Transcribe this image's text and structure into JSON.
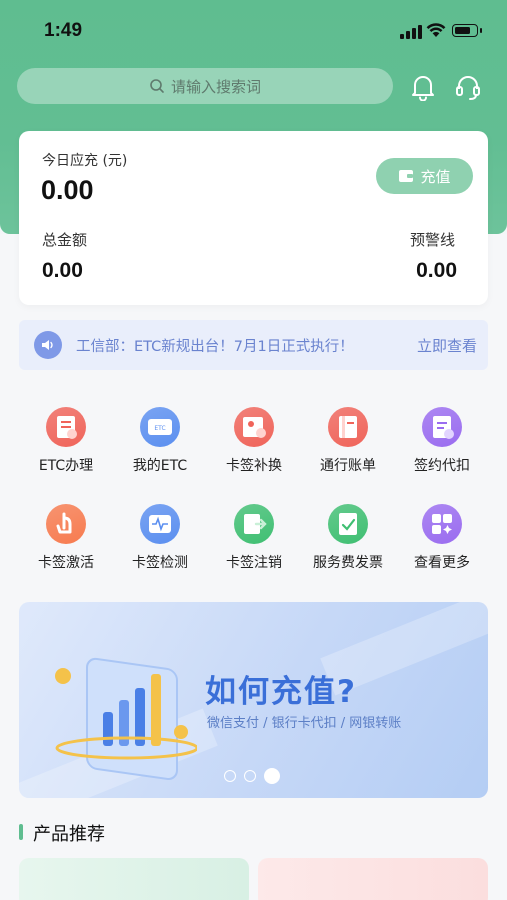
{
  "status_bar": {
    "time": "1:49",
    "battery_level": 0.75
  },
  "search": {
    "placeholder": "请输入搜索词"
  },
  "header_icons": [
    "bell-icon",
    "headset-icon"
  ],
  "balance": {
    "today_label": "今日应充 (元)",
    "today_value": "0.00",
    "recharge_label": "充值",
    "total_label": "总金额",
    "total_value": "0.00",
    "warning_label": "预警线",
    "warning_value": "0.00"
  },
  "notice": {
    "text": "工信部：ETC新规出台！7月1日正式执行！",
    "link": "立即查看"
  },
  "services": [
    {
      "label": "ETC办理",
      "icon": "etc-apply-icon",
      "color": "#f0645a"
    },
    {
      "label": "我的ETC",
      "icon": "my-etc-card-icon",
      "color": "#5b8ff0"
    },
    {
      "label": "卡签补换",
      "icon": "card-replace-icon",
      "color": "#f0645a"
    },
    {
      "label": "通行账单",
      "icon": "toll-bill-icon",
      "color": "#f0645a"
    },
    {
      "label": "签约代扣",
      "icon": "auto-debit-icon",
      "color": "#9a6cf0"
    },
    {
      "label": "卡签激活",
      "icon": "card-activate-icon",
      "color": "#f77b4f"
    },
    {
      "label": "卡签检测",
      "icon": "card-detect-icon",
      "color": "#5b8ff0"
    },
    {
      "label": "卡签注销",
      "icon": "card-cancel-icon",
      "color": "#3fbf72"
    },
    {
      "label": "服务费发票",
      "icon": "invoice-icon",
      "color": "#3fbf72"
    },
    {
      "label": "查看更多",
      "icon": "more-icon",
      "color": "#9a6cf0"
    }
  ],
  "banner": {
    "title": "如何充值?",
    "subtitle": "微信支付 / 银行卡代扣 / 网银转账",
    "slide_count": 3,
    "active_slide": 3
  },
  "products": {
    "title": "产品推荐"
  },
  "colors": {
    "brand_green": "#5fbd90",
    "notice_blue": "#6a83cf",
    "banner_blue": "#3a6fd8"
  }
}
